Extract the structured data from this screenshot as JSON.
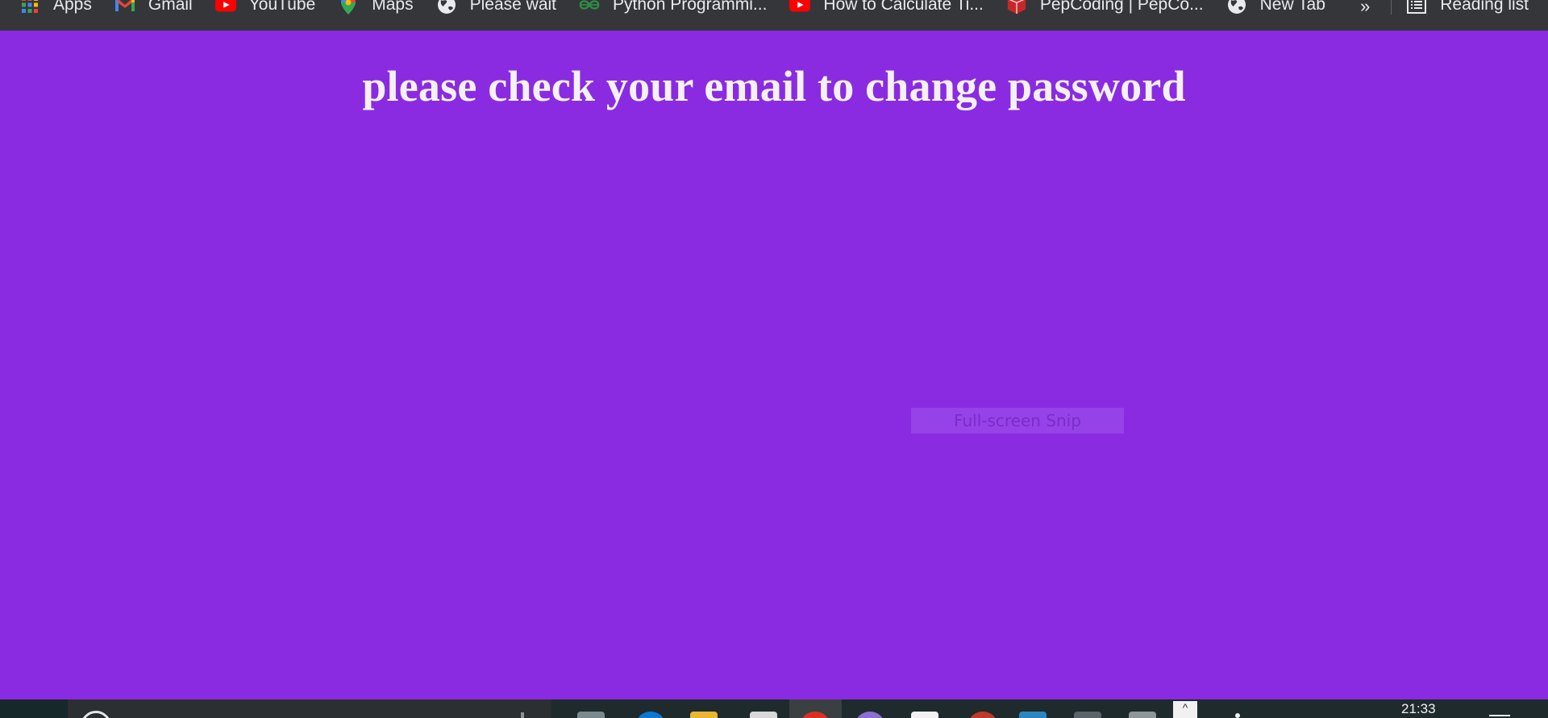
{
  "bookmarks": [
    {
      "label": "Apps",
      "icon": "apps-grid-icon"
    },
    {
      "label": "Gmail",
      "icon": "gmail-icon"
    },
    {
      "label": "YouTube",
      "icon": "youtube-icon"
    },
    {
      "label": "Maps",
      "icon": "maps-pin-icon"
    },
    {
      "label": "Please wait",
      "icon": "globe-icon"
    },
    {
      "label": "Python Programmi...",
      "icon": "geeksforgeeks-icon"
    },
    {
      "label": "How to Calculate Ti...",
      "icon": "youtube-icon"
    },
    {
      "label": "PepCoding | PepCo...",
      "icon": "pepcoding-icon"
    },
    {
      "label": "New Tab",
      "icon": "globe-icon"
    }
  ],
  "bookmarks_overflow": "»",
  "reading_list": "Reading list",
  "page": {
    "title": "please check your email to change password",
    "background": "#8a2be2"
  },
  "snip_tooltip": "Full-screen Snip",
  "taskbar": {
    "time": "21:33"
  }
}
